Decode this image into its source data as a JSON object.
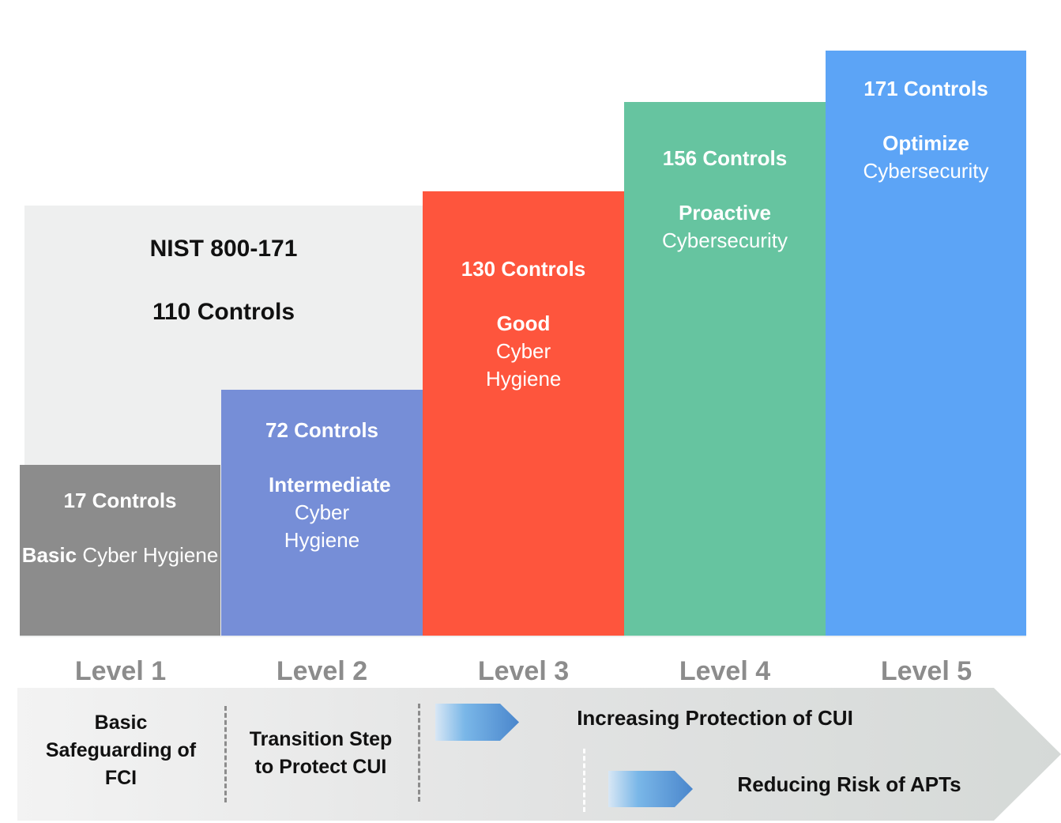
{
  "nist": {
    "title": "NIST 800-171",
    "controls": "110 Controls",
    "color": "#eeefef"
  },
  "levels": [
    {
      "label": "Level 1",
      "controls": "17 Controls",
      "controls_count": 17,
      "desc_bold": "Basic",
      "desc_rest": "Cyber Hygiene",
      "color": "#8c8c8c"
    },
    {
      "label": "Level 2",
      "controls": "72 Controls",
      "controls_count": 72,
      "desc_bold": "Intermediate",
      "desc_rest": "Cyber Hygiene",
      "color": "#768ed7"
    },
    {
      "label": "Level 3",
      "controls": "130 Controls",
      "controls_count": 130,
      "desc_bold": "Good",
      "desc_rest": "Cyber Hygiene",
      "color": "#fe553d"
    },
    {
      "label": "Level 4",
      "controls": "156 Controls",
      "controls_count": 156,
      "desc_bold": "Proactive",
      "desc_rest": "Cybersecurity",
      "color": "#66c4a0"
    },
    {
      "label": "Level 5",
      "controls": "171 Controls",
      "controls_count": 171,
      "desc_bold": "Optimize",
      "desc_rest": "Cybersecurity",
      "color": "#5ca4f6"
    }
  ],
  "band": {
    "segment1": "Basic Safeguarding of FCI",
    "segment1_lines": [
      "Basic",
      "Safeguarding of",
      "FCI"
    ],
    "segment2_lines": [
      "Transition Step",
      "to Protect CUI"
    ],
    "arrow1_label": "Increasing Protection of CUI",
    "arrow2_label": "Reducing Risk of APTs"
  }
}
